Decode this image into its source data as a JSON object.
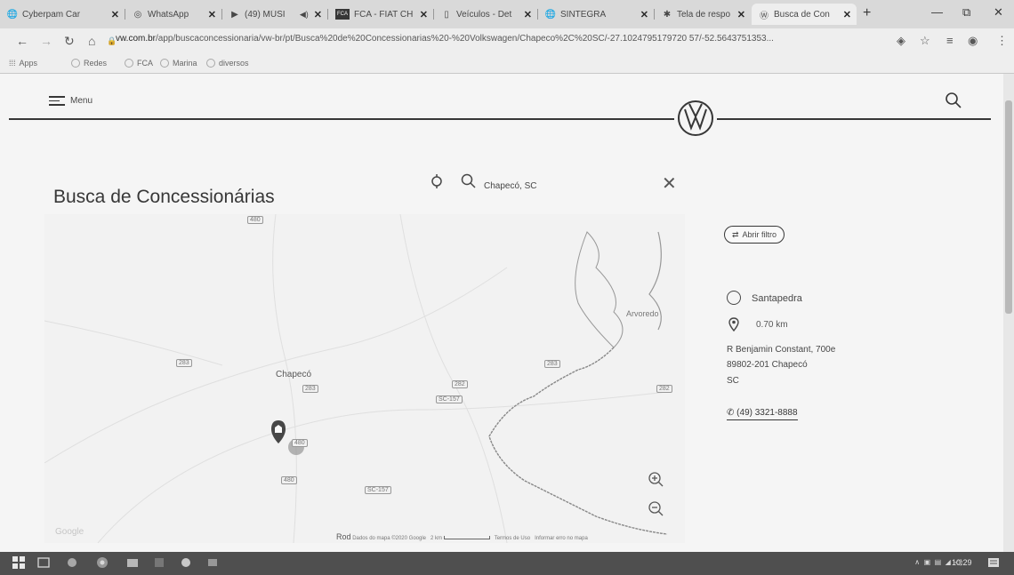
{
  "browser": {
    "tabs": [
      {
        "title": "Cyberpam Car",
        "favicon": "globe-icon"
      },
      {
        "title": "WhatsApp",
        "favicon": "whatsapp-icon"
      },
      {
        "title": "(49) MÚSI",
        "favicon": "youtube-icon"
      },
      {
        "title": "FCA - FIAT CH",
        "favicon": "fca-icon"
      },
      {
        "title": "Veículos - Det",
        "favicon": "doc-icon"
      },
      {
        "title": "SINTEGRA",
        "favicon": "globe-icon"
      },
      {
        "title": "Tela de respo",
        "favicon": "web-icon"
      },
      {
        "title": "Busca de Con",
        "favicon": "vw-icon"
      }
    ],
    "url_domain": "vw.com.br",
    "url_path": "/app/buscaconcessionaria/vw-br/pt/Busca%20de%20Concessionarias%20-%20Volkswagen/Chapeco%2C%20SC/-27.1024795179720 57/-52.5643751353...",
    "bookmarks": [
      "Apps",
      "Redes",
      "FCA",
      "Marina",
      "diversos"
    ]
  },
  "header": {
    "menu_label": "Menu"
  },
  "page": {
    "title": "Busca de Concessionárias",
    "search_value": "Chapecó, SC",
    "filter_label": "Abrir filtro"
  },
  "map": {
    "labels": {
      "arvoredo": "Arvoredo",
      "chapeco": "Chapecó",
      "rod": "Rod"
    },
    "road_badges": [
      "480",
      "283",
      "283",
      "282",
      "283",
      "SC-157",
      "480",
      "282",
      "SC-157",
      "480"
    ],
    "footer": {
      "data": "Dados do mapa ©2020 Google",
      "scale": "2 km",
      "terms": "Termos de Uso",
      "report": "Informar erro no mapa"
    },
    "google": "Google"
  },
  "dealer": {
    "name": "Santapedra",
    "distance": "0.70 km",
    "address_line1": "R Benjamin Constant, 700e",
    "address_line2": "89802-201 Chapecó",
    "address_line3": "SC",
    "phone": "(49) 3321-8888"
  },
  "taskbar": {
    "clock": "10:29"
  }
}
